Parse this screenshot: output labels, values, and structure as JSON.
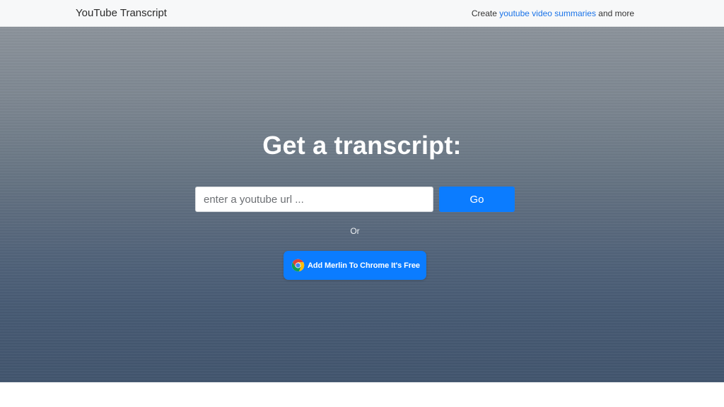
{
  "header": {
    "brand": "YouTube Transcript",
    "nav_prefix": "Create ",
    "nav_link": "youtube video summaries",
    "nav_suffix": " and more"
  },
  "hero": {
    "title": "Get a transcript:",
    "url_placeholder": "enter a youtube url ...",
    "go_label": "Go",
    "or_text": "Or",
    "chrome_button_label": "Add Merlin To Chrome It's Free"
  },
  "icons": {
    "chrome": "chrome-logo-icon"
  },
  "colors": {
    "accent": "#0b7cff",
    "link": "#1a73e8",
    "header_bg": "#f7f8f9"
  }
}
